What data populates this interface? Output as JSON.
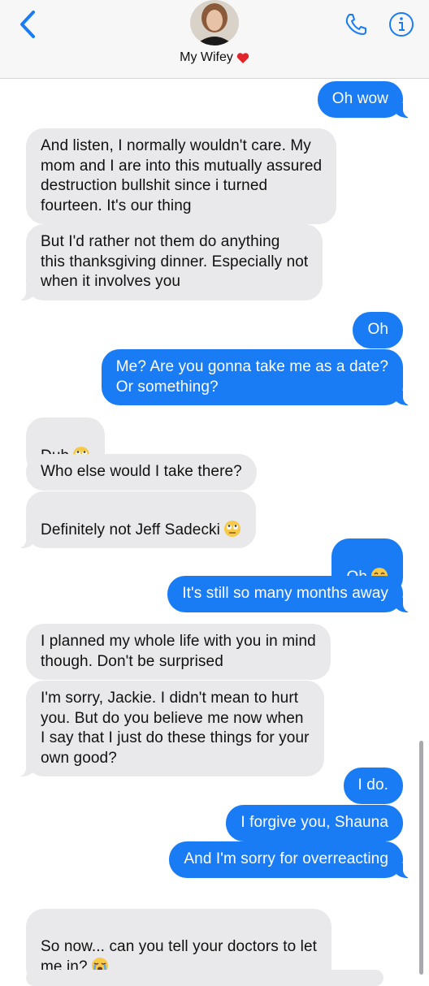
{
  "header": {
    "contact_name": "My Wifey",
    "contact_emoji": "heart",
    "icons": [
      "chevron-left-icon",
      "avatar",
      "phone-icon",
      "info-icon"
    ],
    "accent": "#1a7cf5"
  },
  "messages": [
    {
      "from": "me",
      "text": "Oh wow"
    },
    {
      "from": "them",
      "text": "And listen, I normally wouldn't care. My\nmom and I are into this mutually assured\ndestruction bullshit since i turned\nfourteen. It's our thing"
    },
    {
      "from": "them",
      "text": "But I'd rather not them do anything\nthis thanksgiving dinner. Especially not\nwhen it involves you"
    },
    {
      "from": "me",
      "text": "Oh"
    },
    {
      "from": "me",
      "text": "Me? Are you gonna take me as a date?\nOr something?"
    },
    {
      "from": "them",
      "text": "Duh",
      "emoji": "eye-roll"
    },
    {
      "from": "them",
      "text": "Who else would I take there?"
    },
    {
      "from": "them",
      "text": "Definitely not Jeff Sadecki",
      "emoji": "eye-roll"
    },
    {
      "from": "me",
      "text": "Oh",
      "emoji": "smile"
    },
    {
      "from": "me",
      "text": "It's still so many months away"
    },
    {
      "from": "them",
      "text": "I planned my whole life with you in mind\nthough. Don't be surprised"
    },
    {
      "from": "them",
      "text": "I'm sorry, Jackie. I didn't mean to hurt\nyou. But do you believe me now when\nI say that I just do these things for your\nown good?"
    },
    {
      "from": "me",
      "text": "I do."
    },
    {
      "from": "me",
      "text": "I forgive you, Shauna"
    },
    {
      "from": "me",
      "text": "And I'm sorry for overreacting"
    },
    {
      "from": "them",
      "text": "So now... can you tell your doctors to let\nme in?",
      "emoji": "sob"
    }
  ],
  "colors": {
    "incoming": "#e9e9eb",
    "outgoing": "#1a7cf5",
    "header_bg": "#f7f7f8"
  }
}
